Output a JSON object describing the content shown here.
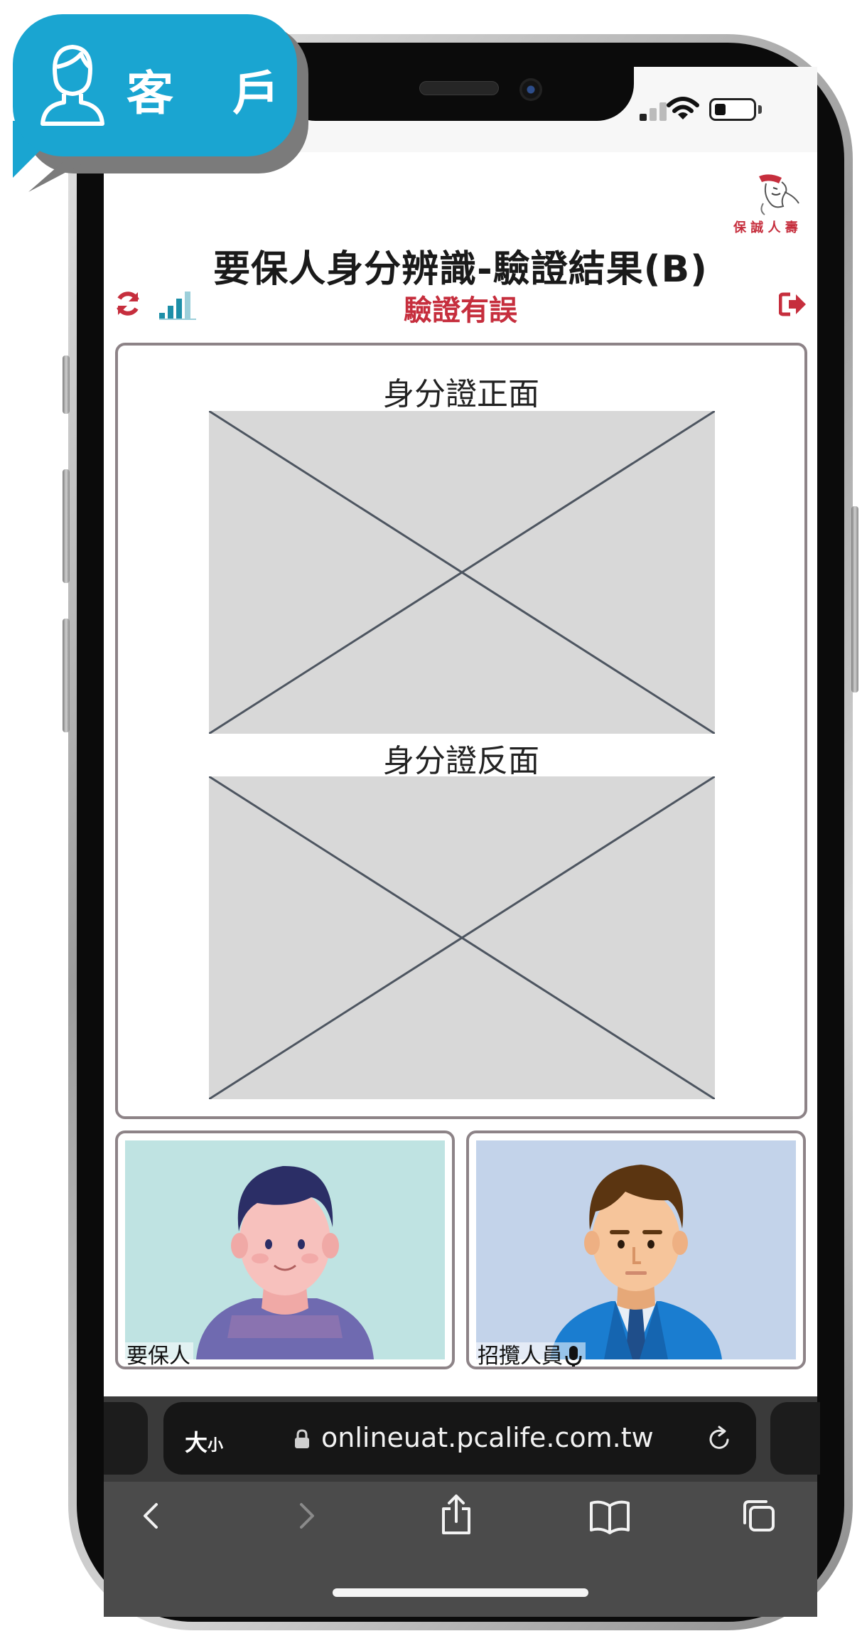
{
  "badge": {
    "label": "客 戶"
  },
  "status_bar": {
    "battery_fraction": 0.3,
    "signal_bars_active": 2
  },
  "page": {
    "title": "要保人身分辨識-驗證結果(B)",
    "status": "驗證有誤",
    "status_color": "#c62e3d"
  },
  "logo": {
    "text": "保 誠 人 壽"
  },
  "id_card": {
    "front_label": "身分證正面",
    "back_label": "身分證反面"
  },
  "videos": {
    "left_label": "要保人",
    "right_label": "招攬人員"
  },
  "safari": {
    "text_size_label": "大",
    "text_size_small": "小",
    "url": "onlineuat.pcalife.com.tw"
  },
  "colors": {
    "badge_blue": "#1aa5d1",
    "network_teal": "#1d8fa8",
    "tile_bg_left": "#bfe3e2",
    "tile_bg_right": "#c3d3ea"
  }
}
